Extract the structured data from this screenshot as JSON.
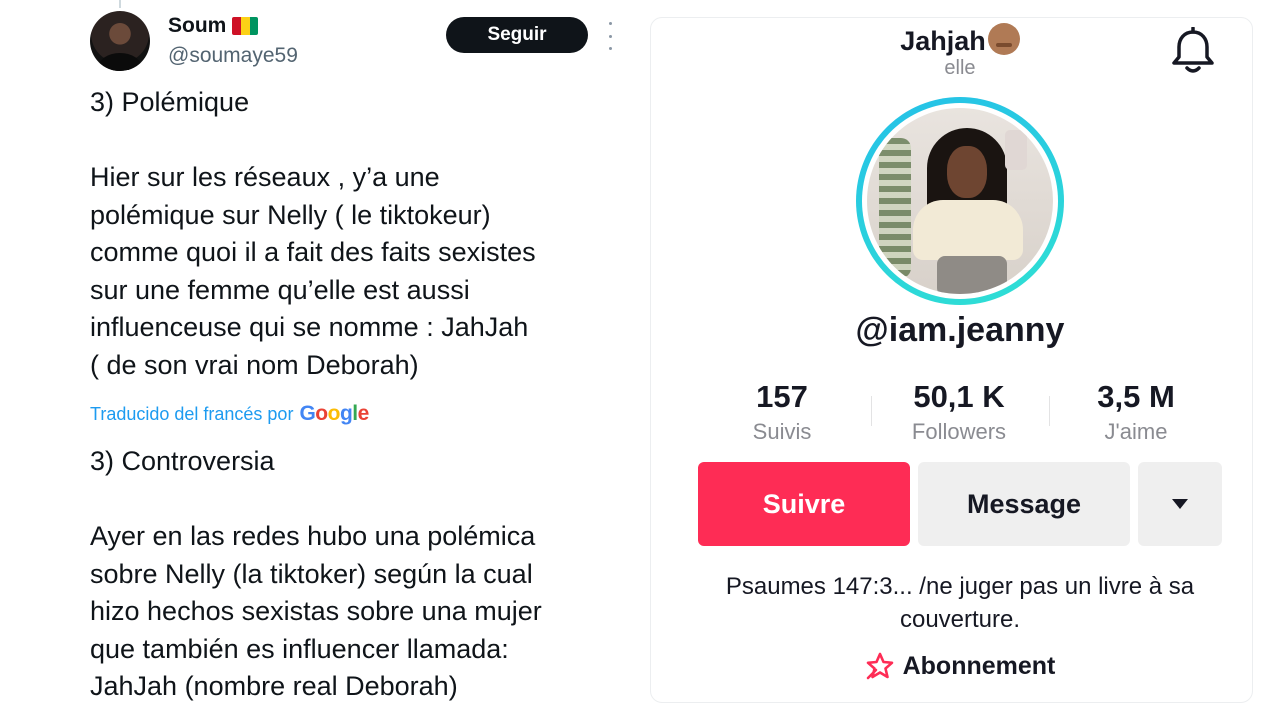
{
  "tweet": {
    "display_name": "Soum",
    "handle": "@soumaye59",
    "follow_label": "Seguir",
    "flag_colors": [
      "#ce1126",
      "#fcd116",
      "#009460"
    ],
    "original_text": "3) Polémique\n\nHier sur les réseaux , y’a une\npolémique sur Nelly ( le tiktokeur)\ncomme quoi il a fait des faits sexistes\nsur une femme qu’elle est aussi\ninfluenceuse qui se nomme : JahJah\n( de son vrai nom Deborah)",
    "translated_by": "Traducido del francés por",
    "translator": "Google",
    "translated_text": "3) Controversia\n\nAyer en las redes hubo una polémica\nsobre Nelly (la tiktoker) según la cual\nhizo hechos sexistas sobre una mujer\nque también es influencer llamada:\nJahJah (nombre real Deborah)"
  },
  "profile": {
    "name": "Jahjah",
    "pronoun": "elle",
    "username": "@iam.jeanny",
    "stats": [
      {
        "value": "157",
        "label": "Suivis"
      },
      {
        "value": "50,1 K",
        "label": "Followers"
      },
      {
        "value": "3,5 M",
        "label": "J'aime"
      }
    ],
    "follow_label": "Suivre",
    "message_label": "Message",
    "bio": "Psaumes 147:3... /ne juger pas un livre à sa\ncouverture.",
    "subscription_label": "Abonnement",
    "accent_color": "#fe2c55"
  },
  "icons": {
    "bell": "bell-icon",
    "more": "more-dots-icon",
    "dropdown": "caret-down-icon",
    "subscription": "star-badge-icon"
  }
}
